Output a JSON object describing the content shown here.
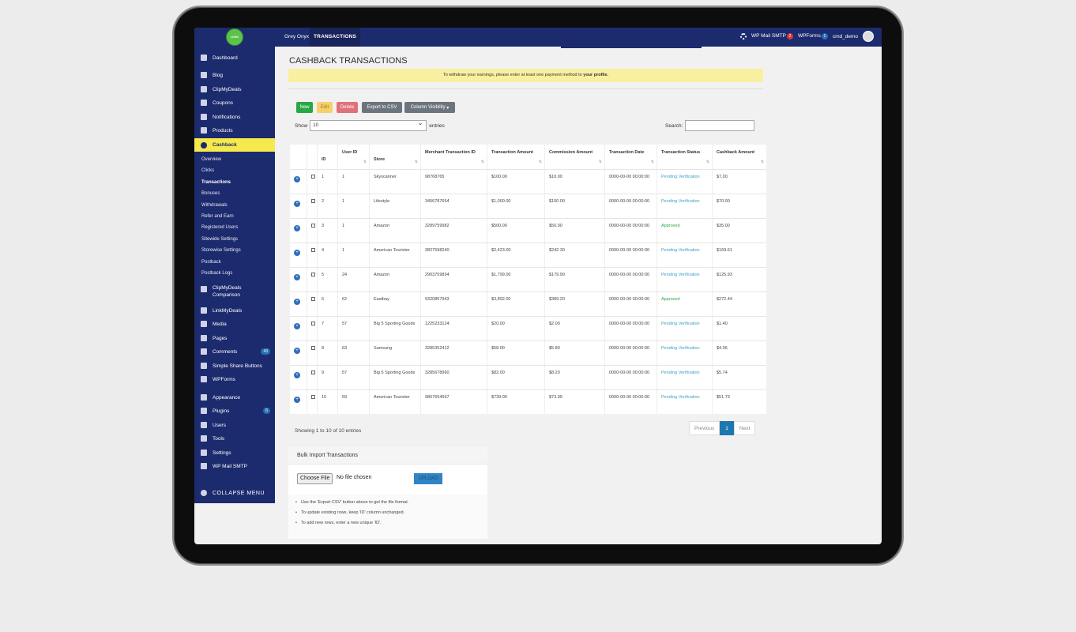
{
  "topbar": {
    "site_name": "Grey Onyx",
    "tab": "TRANSACTIONS",
    "smtp": "WP Mail SMTP",
    "smtp_badge": "2",
    "wpforms": "WPForms",
    "wpforms_badge": "1",
    "user": "cmd_demo"
  },
  "sidebar": {
    "items": [
      {
        "label": "Dashboard",
        "icon": "dashboard-icon"
      },
      {
        "label": "Blog",
        "icon": "pin-icon"
      },
      {
        "label": "ClipMyDeals",
        "icon": "deals-icon"
      },
      {
        "label": "Coupons",
        "icon": "tag-icon"
      },
      {
        "label": "Notifications",
        "icon": "bell-icon"
      },
      {
        "label": "Products",
        "icon": "cart-icon"
      },
      {
        "label": "Cashback",
        "icon": "cashback-icon"
      }
    ],
    "sub_items": [
      "Overview",
      "Clicks",
      "Transactions",
      "Bonuses",
      "Withdrawals",
      "Refer and Earn",
      "Registered Users",
      "Sitewide Settings",
      "Storewise Settings",
      "Postback",
      "Postback Logs"
    ],
    "items2": [
      {
        "label": "ClipMyDeals",
        "label2": "Comparison",
        "icon": "comparison-icon"
      },
      {
        "label": "LinkMyDeals",
        "icon": "shuffle-icon"
      },
      {
        "label": "Media",
        "icon": "media-icon"
      },
      {
        "label": "Pages",
        "icon": "pages-icon"
      },
      {
        "label": "Comments",
        "icon": "comment-icon",
        "badge": "43"
      },
      {
        "label": "Simple Share Buttons",
        "icon": "share-icon"
      },
      {
        "label": "WPForms",
        "icon": "forms-icon"
      },
      {
        "label": "Appearance",
        "icon": "brush-icon"
      },
      {
        "label": "Plugins",
        "icon": "plugin-icon",
        "badge": "6"
      },
      {
        "label": "Users",
        "icon": "user-icon"
      },
      {
        "label": "Tools",
        "icon": "wrench-icon"
      },
      {
        "label": "Settings",
        "icon": "settings-icon"
      },
      {
        "label": "WP Mail SMTP",
        "icon": "mail-icon"
      }
    ],
    "collapse": "COLLAPSE MENU"
  },
  "page": {
    "title": "CASHBACK TRANSACTIONS",
    "notice_text": "To withdraw your earnings, please enter at least one payment method to ",
    "notice_link": "your profile."
  },
  "toolbar": {
    "new": "New",
    "edit": "Edit",
    "delete": "Delete",
    "export": "Export to CSV",
    "visibility": "Column Visibility"
  },
  "controls": {
    "show": "Show",
    "entries_value": "10",
    "entries": "entries",
    "search": "Search:"
  },
  "table": {
    "headers": [
      "ID",
      "User ID",
      "Store",
      "Merchant Transaction ID",
      "Transaction Amount",
      "Commission Amount",
      "Transaction Date",
      "Transaction Status",
      "Cashback Amount"
    ],
    "rows": [
      {
        "id": "1",
        "user": "1",
        "store": "Skyscanner",
        "mid": "98768765",
        "amt": "$100.00",
        "comm": "$10.00",
        "date": "0000-00-00 00:00:00",
        "status": "Pending Verification",
        "cb": "$7.00"
      },
      {
        "id": "2",
        "user": "1",
        "store": "Lifestyle",
        "mid": "3456787654",
        "amt": "$1,000.00",
        "comm": "$100.00",
        "date": "0000-00-00 00:00:00",
        "status": "Pending Verification",
        "cb": "$70.00"
      },
      {
        "id": "3",
        "user": "1",
        "store": "Amazon",
        "mid": "3289759982",
        "amt": "$500.00",
        "comm": "$50.00",
        "date": "0000-00-00 00:00:00",
        "status": "Approved",
        "cb": "$35.00"
      },
      {
        "id": "4",
        "user": "1",
        "store": "American Tourister",
        "mid": "3827598240",
        "amt": "$2,423.00",
        "comm": "$242.30",
        "date": "0000-00-00 00:00:00",
        "status": "Pending Verification",
        "cb": "$169.61"
      },
      {
        "id": "5",
        "user": "24",
        "store": "Amazon",
        "mid": "2903759834",
        "amt": "$1,799.00",
        "comm": "$179.90",
        "date": "0000-00-00 00:00:00",
        "status": "Pending Verification",
        "cb": "$125.93"
      },
      {
        "id": "6",
        "user": "62",
        "store": "Eastbay",
        "mid": "9320857943",
        "amt": "$3,892.00",
        "comm": "$389.20",
        "date": "0000-00-00 00:00:00",
        "status": "Approved",
        "cb": "$272.44"
      },
      {
        "id": "7",
        "user": "57",
        "store": "Big 5 Sporting Goods",
        "mid": "1225233124",
        "amt": "$20.00",
        "comm": "$2.00",
        "date": "0000-00-00 00:00:00",
        "status": "Pending Verification",
        "cb": "$1.40"
      },
      {
        "id": "8",
        "user": "63",
        "store": "Samsung",
        "mid": "3285352412",
        "amt": "$58.00",
        "comm": "$5.80",
        "date": "0000-00-00 00:00:00",
        "status": "Pending Verification",
        "cb": "$4.06"
      },
      {
        "id": "9",
        "user": "57",
        "store": "Big 5 Sporting Goods",
        "mid": "3285678960",
        "amt": "$82.00",
        "comm": "$8.20",
        "date": "0000-00-00 00:00:00",
        "status": "Pending Verification",
        "cb": "$5.74"
      },
      {
        "id": "10",
        "user": "69",
        "store": "American Tourister",
        "mid": "9867654567",
        "amt": "$739.00",
        "comm": "$73.90",
        "date": "0000-00-00 00:00:00",
        "status": "Pending Verification",
        "cb": "$51.73"
      }
    ]
  },
  "footer": {
    "info": "Showing 1 to 10 of 10 entries",
    "prev": "Previous",
    "page": "1",
    "next": "Next"
  },
  "bulk": {
    "title": "Bulk Import Transactions",
    "choose": "Choose File",
    "no_file": "No file chosen",
    "upload": "UPLOAD",
    "notes": [
      "Use the 'Export CSV' button above to get the file format.",
      "To update existing rows, keep 'ID' column unchanged.",
      "To add new rows, enter a new unique 'ID'."
    ]
  },
  "colors": {
    "nav": "#1c2a6e",
    "active": "#f5e94b",
    "pending": "#3ba0c8",
    "approved": "#28a745"
  }
}
